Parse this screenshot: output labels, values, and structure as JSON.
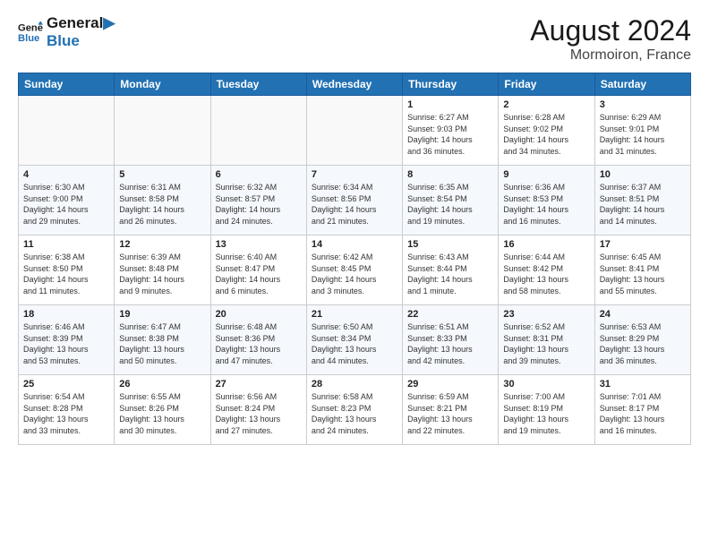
{
  "header": {
    "logo_line1": "General",
    "logo_line2": "Blue",
    "main_title": "August 2024",
    "subtitle": "Mormoiron, France"
  },
  "weekdays": [
    "Sunday",
    "Monday",
    "Tuesday",
    "Wednesday",
    "Thursday",
    "Friday",
    "Saturday"
  ],
  "weeks": [
    [
      {
        "day": "",
        "info": ""
      },
      {
        "day": "",
        "info": ""
      },
      {
        "day": "",
        "info": ""
      },
      {
        "day": "",
        "info": ""
      },
      {
        "day": "1",
        "info": "Sunrise: 6:27 AM\nSunset: 9:03 PM\nDaylight: 14 hours\nand 36 minutes."
      },
      {
        "day": "2",
        "info": "Sunrise: 6:28 AM\nSunset: 9:02 PM\nDaylight: 14 hours\nand 34 minutes."
      },
      {
        "day": "3",
        "info": "Sunrise: 6:29 AM\nSunset: 9:01 PM\nDaylight: 14 hours\nand 31 minutes."
      }
    ],
    [
      {
        "day": "4",
        "info": "Sunrise: 6:30 AM\nSunset: 9:00 PM\nDaylight: 14 hours\nand 29 minutes."
      },
      {
        "day": "5",
        "info": "Sunrise: 6:31 AM\nSunset: 8:58 PM\nDaylight: 14 hours\nand 26 minutes."
      },
      {
        "day": "6",
        "info": "Sunrise: 6:32 AM\nSunset: 8:57 PM\nDaylight: 14 hours\nand 24 minutes."
      },
      {
        "day": "7",
        "info": "Sunrise: 6:34 AM\nSunset: 8:56 PM\nDaylight: 14 hours\nand 21 minutes."
      },
      {
        "day": "8",
        "info": "Sunrise: 6:35 AM\nSunset: 8:54 PM\nDaylight: 14 hours\nand 19 minutes."
      },
      {
        "day": "9",
        "info": "Sunrise: 6:36 AM\nSunset: 8:53 PM\nDaylight: 14 hours\nand 16 minutes."
      },
      {
        "day": "10",
        "info": "Sunrise: 6:37 AM\nSunset: 8:51 PM\nDaylight: 14 hours\nand 14 minutes."
      }
    ],
    [
      {
        "day": "11",
        "info": "Sunrise: 6:38 AM\nSunset: 8:50 PM\nDaylight: 14 hours\nand 11 minutes."
      },
      {
        "day": "12",
        "info": "Sunrise: 6:39 AM\nSunset: 8:48 PM\nDaylight: 14 hours\nand 9 minutes."
      },
      {
        "day": "13",
        "info": "Sunrise: 6:40 AM\nSunset: 8:47 PM\nDaylight: 14 hours\nand 6 minutes."
      },
      {
        "day": "14",
        "info": "Sunrise: 6:42 AM\nSunset: 8:45 PM\nDaylight: 14 hours\nand 3 minutes."
      },
      {
        "day": "15",
        "info": "Sunrise: 6:43 AM\nSunset: 8:44 PM\nDaylight: 14 hours\nand 1 minute."
      },
      {
        "day": "16",
        "info": "Sunrise: 6:44 AM\nSunset: 8:42 PM\nDaylight: 13 hours\nand 58 minutes."
      },
      {
        "day": "17",
        "info": "Sunrise: 6:45 AM\nSunset: 8:41 PM\nDaylight: 13 hours\nand 55 minutes."
      }
    ],
    [
      {
        "day": "18",
        "info": "Sunrise: 6:46 AM\nSunset: 8:39 PM\nDaylight: 13 hours\nand 53 minutes."
      },
      {
        "day": "19",
        "info": "Sunrise: 6:47 AM\nSunset: 8:38 PM\nDaylight: 13 hours\nand 50 minutes."
      },
      {
        "day": "20",
        "info": "Sunrise: 6:48 AM\nSunset: 8:36 PM\nDaylight: 13 hours\nand 47 minutes."
      },
      {
        "day": "21",
        "info": "Sunrise: 6:50 AM\nSunset: 8:34 PM\nDaylight: 13 hours\nand 44 minutes."
      },
      {
        "day": "22",
        "info": "Sunrise: 6:51 AM\nSunset: 8:33 PM\nDaylight: 13 hours\nand 42 minutes."
      },
      {
        "day": "23",
        "info": "Sunrise: 6:52 AM\nSunset: 8:31 PM\nDaylight: 13 hours\nand 39 minutes."
      },
      {
        "day": "24",
        "info": "Sunrise: 6:53 AM\nSunset: 8:29 PM\nDaylight: 13 hours\nand 36 minutes."
      }
    ],
    [
      {
        "day": "25",
        "info": "Sunrise: 6:54 AM\nSunset: 8:28 PM\nDaylight: 13 hours\nand 33 minutes."
      },
      {
        "day": "26",
        "info": "Sunrise: 6:55 AM\nSunset: 8:26 PM\nDaylight: 13 hours\nand 30 minutes."
      },
      {
        "day": "27",
        "info": "Sunrise: 6:56 AM\nSunset: 8:24 PM\nDaylight: 13 hours\nand 27 minutes."
      },
      {
        "day": "28",
        "info": "Sunrise: 6:58 AM\nSunset: 8:23 PM\nDaylight: 13 hours\nand 24 minutes."
      },
      {
        "day": "29",
        "info": "Sunrise: 6:59 AM\nSunset: 8:21 PM\nDaylight: 13 hours\nand 22 minutes."
      },
      {
        "day": "30",
        "info": "Sunrise: 7:00 AM\nSunset: 8:19 PM\nDaylight: 13 hours\nand 19 minutes."
      },
      {
        "day": "31",
        "info": "Sunrise: 7:01 AM\nSunset: 8:17 PM\nDaylight: 13 hours\nand 16 minutes."
      }
    ]
  ]
}
